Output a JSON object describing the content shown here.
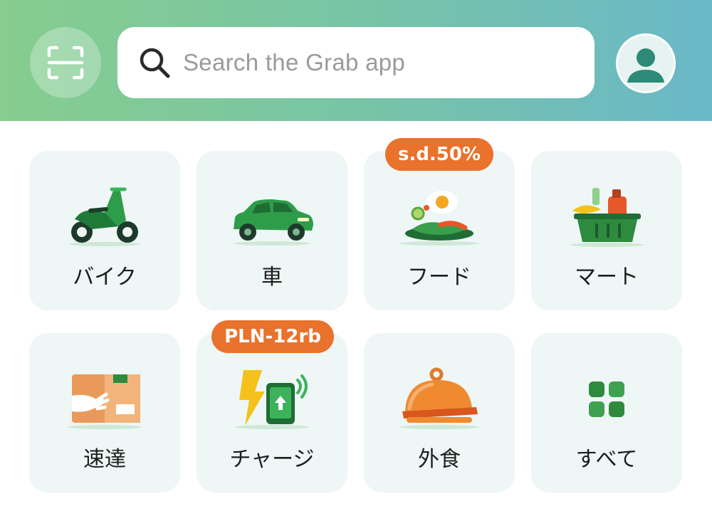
{
  "header": {
    "search_placeholder": "Search the Grab app",
    "scan_icon": "scan-icon",
    "search_icon": "search-icon",
    "avatar_icon": "user-avatar-icon"
  },
  "services": [
    {
      "label": "バイク",
      "icon": "motorbike-icon"
    },
    {
      "label": "車",
      "icon": "car-icon"
    },
    {
      "label": "フード",
      "icon": "food-plate-icon",
      "badge": "s.d.50%"
    },
    {
      "label": "マート",
      "icon": "grocery-basket-icon"
    },
    {
      "label": "速達",
      "icon": "parcel-hand-icon"
    },
    {
      "label": "チャージ",
      "icon": "topup-bolt-phone-icon",
      "badge": "PLN-12rb"
    },
    {
      "label": "外食",
      "icon": "dining-cloche-icon"
    },
    {
      "label": "すべて",
      "icon": "all-services-grid-icon"
    }
  ],
  "colors": {
    "header_gradient_start": "#86cd8e",
    "header_gradient_end": "#6ab8c8",
    "badge": "#e9722c",
    "tile_bg": "#eef6f6",
    "brand_green": "#2e8b3e"
  }
}
